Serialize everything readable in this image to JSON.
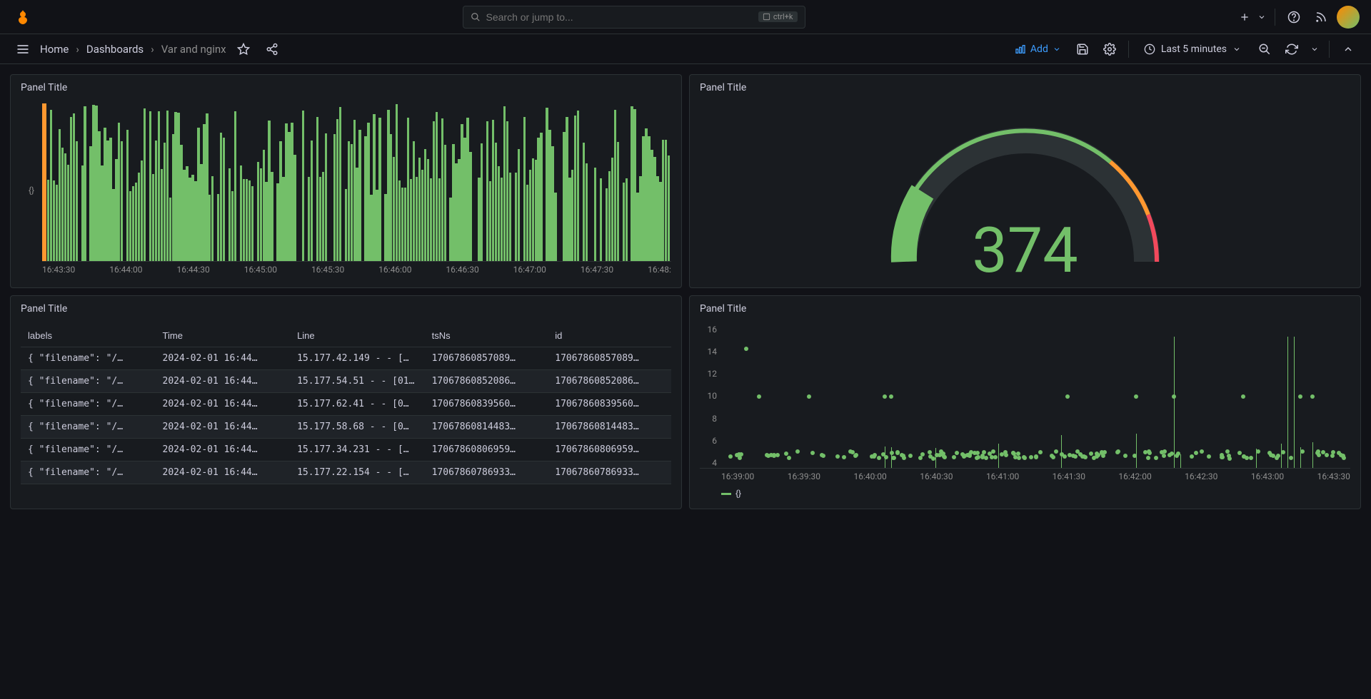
{
  "search": {
    "placeholder": "Search or jump to...",
    "shortcut": "ctrl+k"
  },
  "breadcrumb": {
    "home": "Home",
    "dashboards": "Dashboards",
    "current": "Var and nginx"
  },
  "toolbar": {
    "add": "Add",
    "time_range": "Last 5 minutes"
  },
  "panels": {
    "p1": {
      "title": "Panel Title",
      "ylabel": "{}"
    },
    "p2": {
      "title": "Panel Title"
    },
    "p3": {
      "title": "Panel Title"
    },
    "p4": {
      "title": "Panel Title",
      "legend": "{}"
    }
  },
  "gauge": {
    "value": "374"
  },
  "table": {
    "headers": [
      "labels",
      "Time",
      "Line",
      "tsNs",
      "id"
    ],
    "rows": [
      [
        "{ \"filename\": \"/…",
        "2024-02-01 16:44…",
        "15.177.42.149 - - […",
        "17067860857089…",
        "17067860857089…"
      ],
      [
        "{ \"filename\": \"/…",
        "2024-02-01 16:44…",
        "15.177.54.51 - - [01…",
        "17067860852086…",
        "17067860852086…"
      ],
      [
        "{ \"filename\": \"/…",
        "2024-02-01 16:44…",
        "15.177.62.41 - - [0…",
        "17067860839560…",
        "17067860839560…"
      ],
      [
        "{ \"filename\": \"/…",
        "2024-02-01 16:44…",
        "15.177.58.68 - - [0…",
        "17067860814483…",
        "17067860814483…"
      ],
      [
        "{ \"filename\": \"/…",
        "2024-02-01 16:44…",
        "15.177.34.231 - - […",
        "17067860806959…",
        "17067860806959…"
      ],
      [
        "{ \"filename\": \"/…",
        "2024-02-01 16:44…",
        "15.177.22.154 - - […",
        "17067860786933…",
        "17067860786933…"
      ]
    ]
  },
  "chart_data": [
    {
      "type": "bar",
      "panel": "p1",
      "title": "Panel Title",
      "ylabel": "{}",
      "x_ticks": [
        "16:43:30",
        "16:44:00",
        "16:44:30",
        "16:45:00",
        "16:45:30",
        "16:46:00",
        "16:46:30",
        "16:47:00",
        "16:47:30",
        "16:48:"
      ],
      "note": "dense vertical log-event bars, ~200+ thin green bars of varying height across time axis; leftmost group shaded orange"
    },
    {
      "type": "gauge",
      "panel": "p2",
      "value": 374,
      "range": [
        0,
        500
      ],
      "thresholds": [
        {
          "color": "#73bf69",
          "to": 360
        },
        {
          "color": "#ff9830",
          "to": 440
        },
        {
          "color": "#f2495c",
          "to": 500
        }
      ],
      "fill_to": 120
    },
    {
      "type": "table",
      "panel": "p3",
      "columns": [
        "labels",
        "Time",
        "Line",
        "tsNs",
        "id"
      ]
    },
    {
      "type": "scatter",
      "panel": "p4",
      "ylabel": "",
      "ylim": [
        4,
        16
      ],
      "y_ticks": [
        4,
        6,
        8,
        10,
        12,
        14,
        16
      ],
      "x_ticks": [
        "16:39:00",
        "16:39:30",
        "16:40:00",
        "16:40:30",
        "16:41:00",
        "16:41:30",
        "16:42:00",
        "16:42:30",
        "16:43:00",
        "16:43:30"
      ],
      "series": [
        {
          "name": "{}",
          "note": "dense points mostly at y≈5, scattered points at y≈10, occasional spikes to y≈14-16"
        }
      ]
    }
  ]
}
